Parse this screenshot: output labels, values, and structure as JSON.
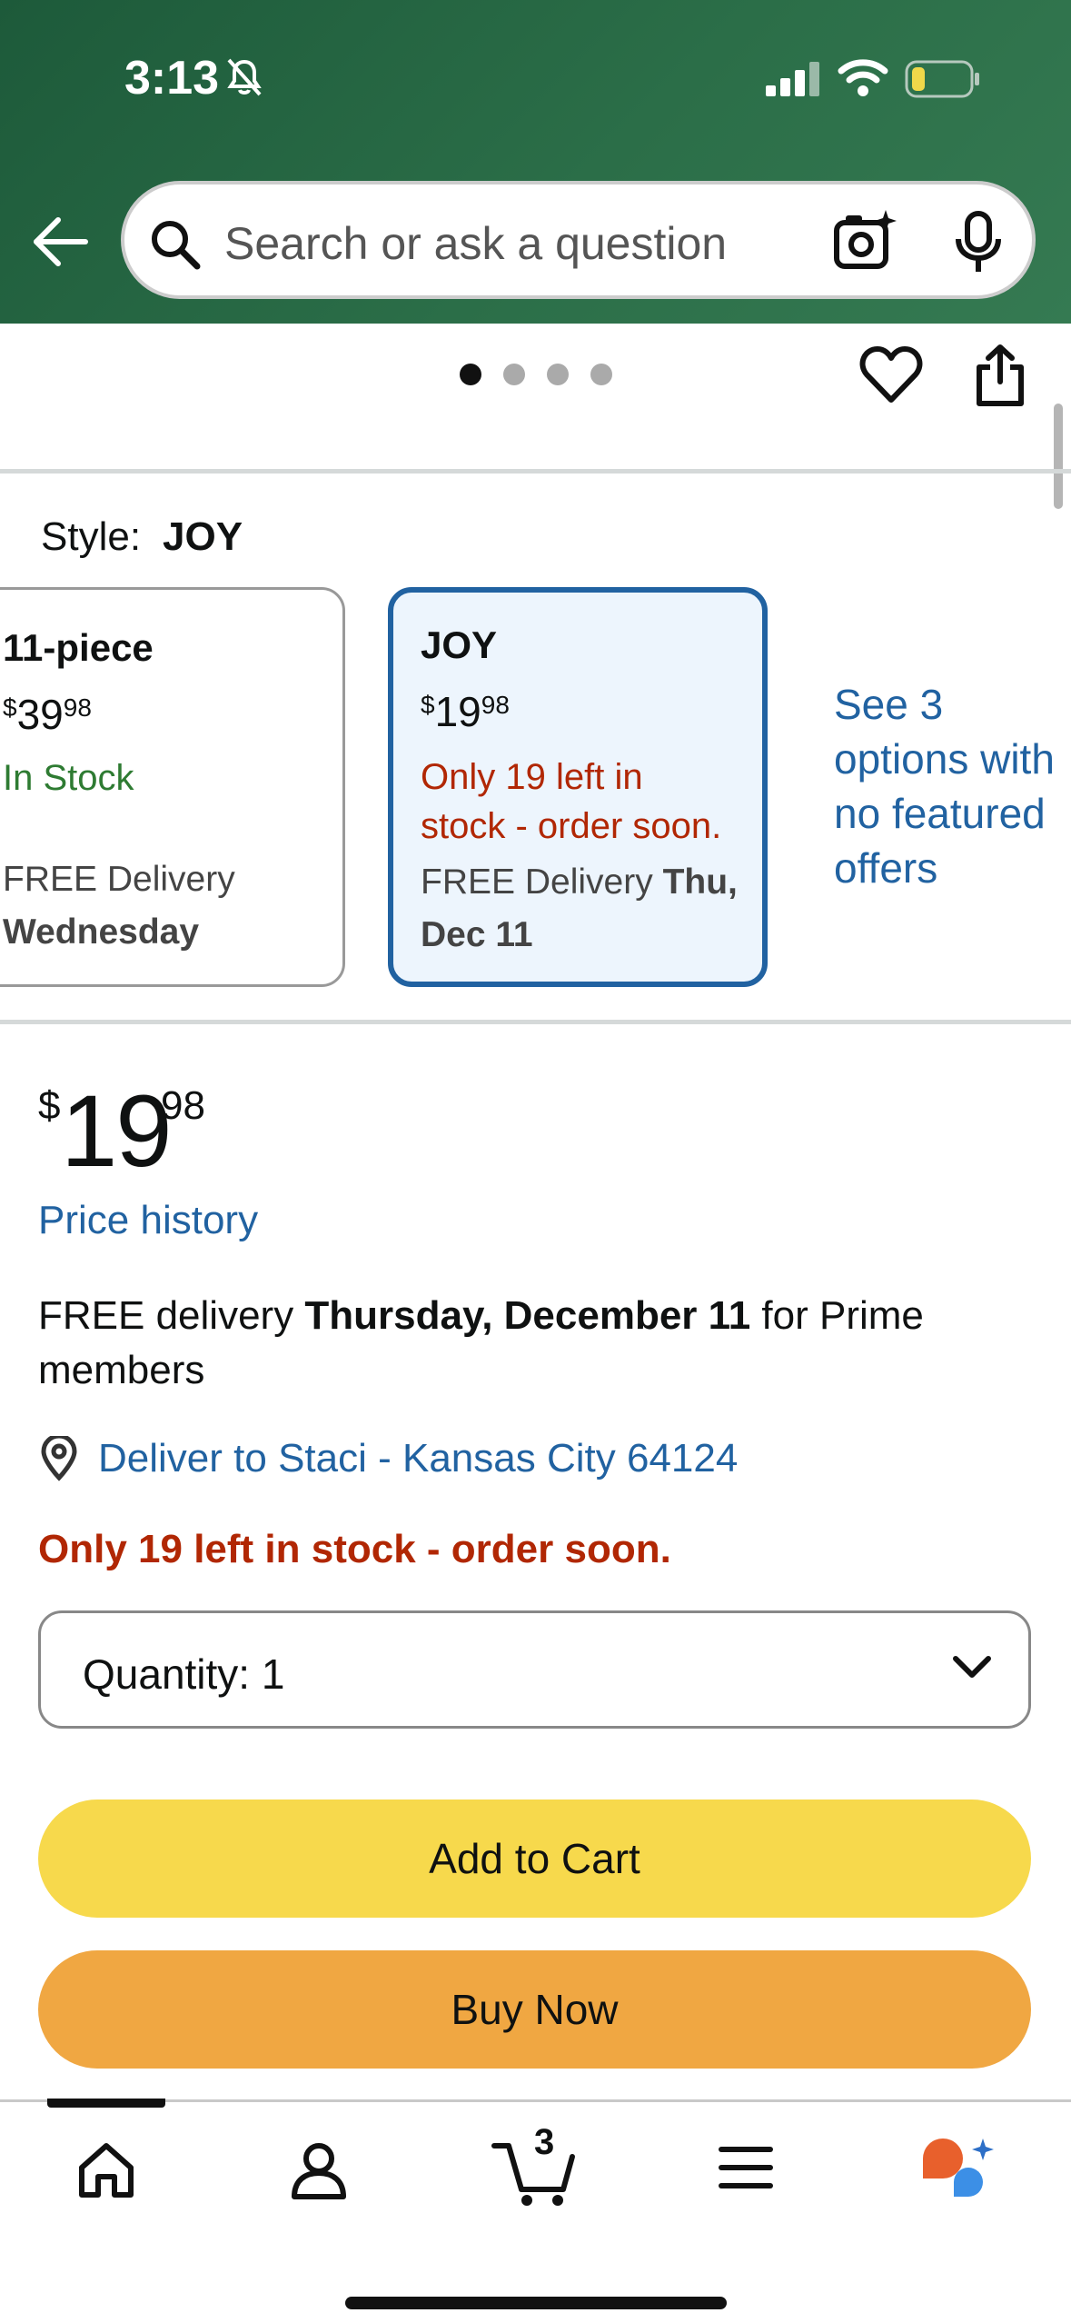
{
  "status": {
    "time": "3:13"
  },
  "search": {
    "placeholder": "Search or ask a question"
  },
  "product": {
    "style_label": "Style:",
    "style_value": "JOY",
    "options": [
      {
        "title": "11-piece",
        "price_symbol": "$",
        "price_whole": "39",
        "price_cents": "98",
        "stock": "In Stock",
        "delivery_prefix": "FREE Delivery",
        "delivery_day": "Wednesday"
      },
      {
        "title": "JOY",
        "price_symbol": "$",
        "price_whole": "19",
        "price_cents": "98",
        "stock_line1": "Only 19 left in",
        "stock_line2": "stock - order soon.",
        "delivery_prefix": "FREE Delivery",
        "delivery_day1": "Thu,",
        "delivery_day2": "Dec 11"
      }
    ],
    "see_options": "See 3 options with no featured offers",
    "price_symbol": "$",
    "price_whole": "19",
    "price_cents": "98",
    "price_history": "Price history",
    "delivery_prefix": "FREE delivery",
    "delivery_date": "Thursday, December 11",
    "delivery_suffix": "for Prime members",
    "deliver_to": "Deliver to Staci - Kansas City 64124",
    "stock_warning": "Only 19 left in stock - order soon.",
    "quantity_label": "Quantity:",
    "quantity_value": "1",
    "add_to_cart": "Add to Cart",
    "buy_now": "Buy Now"
  },
  "nav": {
    "cart_count": "3"
  },
  "colors": {
    "header": "#2b6e48",
    "link": "#2162a1",
    "alert": "#b12704",
    "stock_ok": "#2e7b32",
    "cart_btn": "#f7d94c",
    "buy_btn": "#f0a742"
  }
}
